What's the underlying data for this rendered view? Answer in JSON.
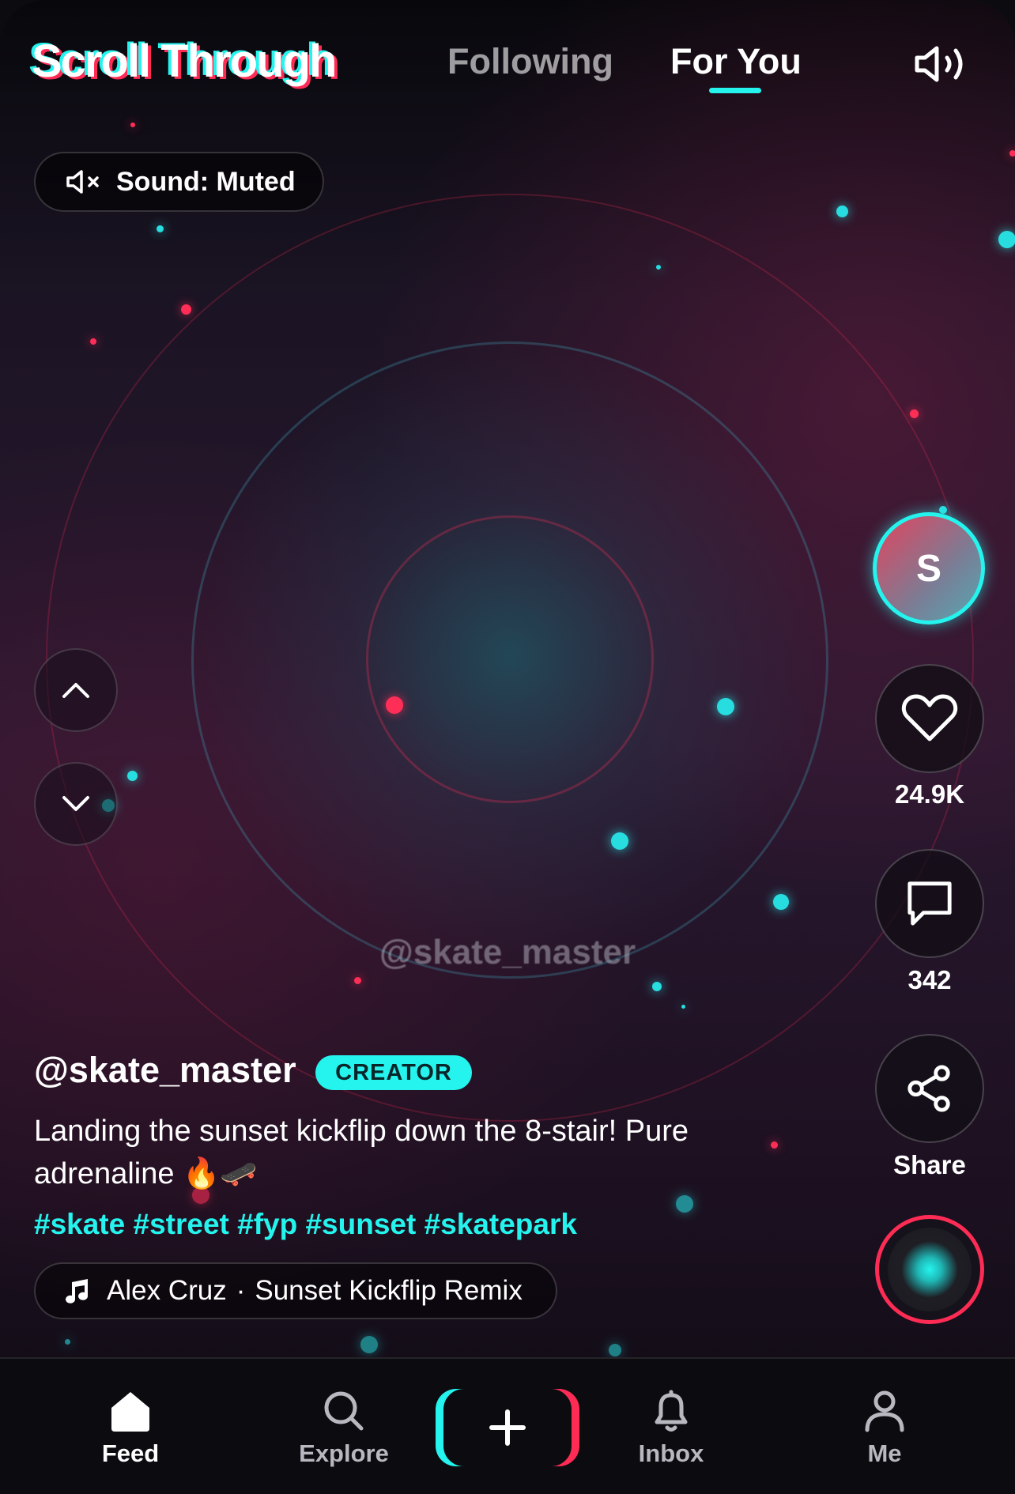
{
  "app": {
    "logo": "Scroll Through"
  },
  "header": {
    "tabs": [
      {
        "label": "Following",
        "active": false
      },
      {
        "label": "For You",
        "active": true
      }
    ],
    "speaker_icon": "speaker-volume-icon"
  },
  "sound_status": {
    "label": "Sound: Muted",
    "icon": "speaker-muted-icon"
  },
  "video": {
    "watermark": "@skate_master"
  },
  "rail": {
    "avatar_initial": "S",
    "likes": "24.9K",
    "comments": "342",
    "share_label": "Share"
  },
  "post": {
    "username": "@skate_master",
    "badge": "CREATOR",
    "caption": "Landing the sunset kickflip down the 8-stair! Pure adrenaline 🔥🛹",
    "hashtags": "#skate #street #fyp #sunset #skatepark",
    "music_artist": "Alex Cruz",
    "music_separator": "·",
    "music_title": "Sunset Kickflip Remix"
  },
  "bottom_nav": {
    "feed": "Feed",
    "explore": "Explore",
    "inbox": "Inbox",
    "me": "Me"
  },
  "colors": {
    "accent_cyan": "#25f4ee",
    "accent_red": "#fe2c55",
    "background": "#0c0c10"
  }
}
